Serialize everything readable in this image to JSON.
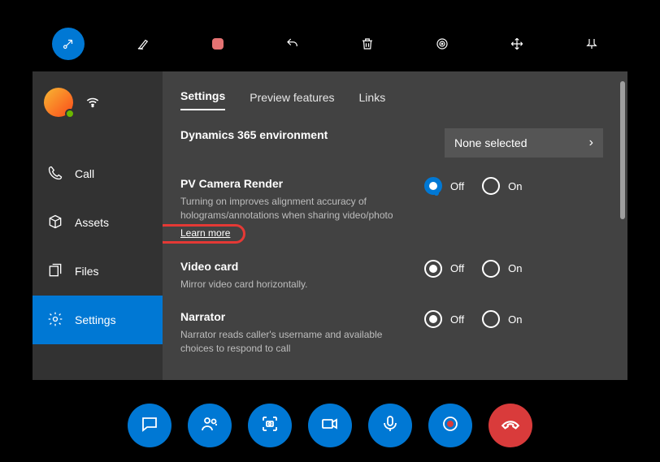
{
  "top_tools": [
    "arrow",
    "ink",
    "stop",
    "undo",
    "delete",
    "target",
    "move",
    "pin"
  ],
  "sidebar": {
    "items": [
      {
        "label": "Call"
      },
      {
        "label": "Assets"
      },
      {
        "label": "Files"
      },
      {
        "label": "Settings"
      }
    ]
  },
  "tabs": {
    "settings": "Settings",
    "preview": "Preview features",
    "links": "Links"
  },
  "settings": {
    "env": {
      "title": "Dynamics 365 environment",
      "select_value": "None selected"
    },
    "pv": {
      "title": "PV Camera Render",
      "desc": "Turning on improves alignment accuracy of holograms/annotations when sharing video/photo",
      "learn_more": "Learn more"
    },
    "video": {
      "title": "Video card",
      "desc": "Mirror video card horizontally."
    },
    "narrator": {
      "title": "Narrator",
      "desc": "Narrator reads caller's username and available choices to respond to call"
    }
  },
  "radio": {
    "off": "Off",
    "on": "On"
  },
  "bottom_actions": [
    "chat",
    "contacts",
    "snapshot",
    "video",
    "mic",
    "record",
    "hangup"
  ]
}
